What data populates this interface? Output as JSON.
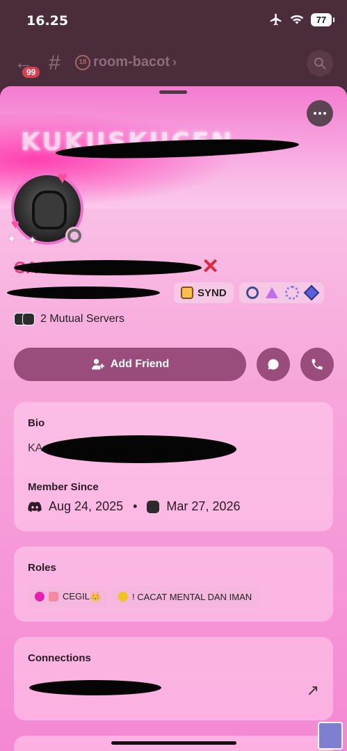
{
  "status_bar": {
    "time": "16.25",
    "battery": "77"
  },
  "channel": {
    "unread_badge": "99",
    "name": "room-bacot",
    "age_icon": "18"
  },
  "profile": {
    "banner_text": "KUKUSKUCEN",
    "display_name": "CACAT",
    "username": "m",
    "tag": "SYND",
    "mutual_servers": "2 Mutual Servers",
    "add_friend_label": "Add Friend"
  },
  "bio": {
    "title": "Bio",
    "text": "KA"
  },
  "member_since": {
    "title": "Member Since",
    "discord_date": "Aug 24, 2025",
    "separator": "•",
    "server_date": "Mar 27, 2026"
  },
  "roles": {
    "title": "Roles",
    "items": [
      {
        "label": "CEGIL👑",
        "color": "#e61fb0"
      },
      {
        "label": "! CACAT MENTAL DAN IMAN",
        "color": "#f2c318"
      }
    ]
  },
  "connections": {
    "title": "Connections",
    "account": ""
  },
  "colors": {
    "accent": "#9a4c7c",
    "header": "#4b2c3b"
  }
}
